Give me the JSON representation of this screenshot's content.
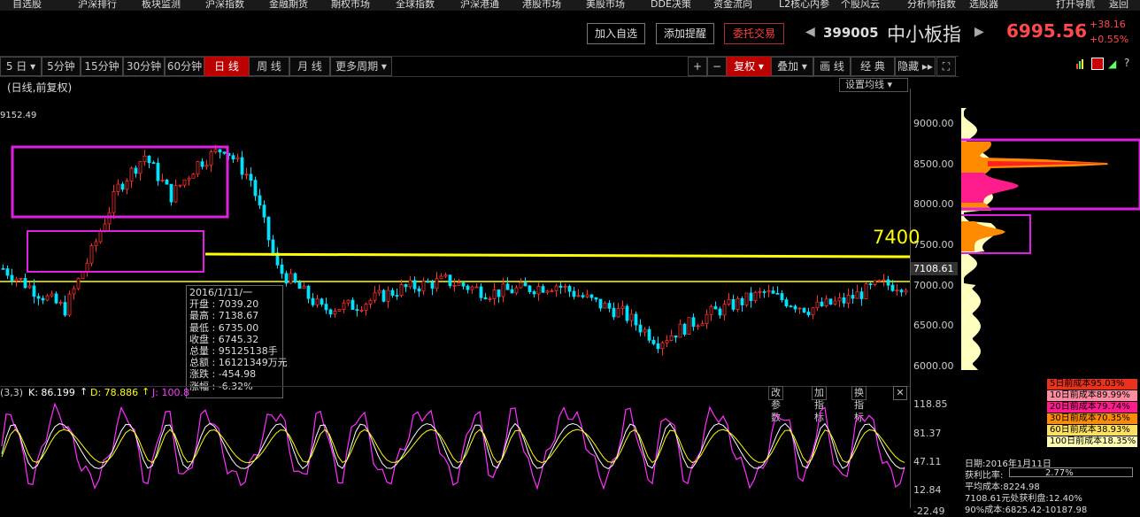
{
  "menu": [
    "自选股",
    "沪深排行",
    "板块监测",
    "沪深指数",
    "金融期货",
    "期权市场",
    "全球指数",
    "沪深港通",
    "港股市场",
    "美股市场",
    "DDE决策",
    "资金流向",
    "L2核心内参",
    "个股风云",
    "分析师指数",
    "选股器",
    "打开导航",
    "返回"
  ],
  "header": {
    "add_watch": "加入自选",
    "add_alert": "添加提醒",
    "trade": "委托交易",
    "code": "399005",
    "name": "中小板指",
    "price": "6995.56",
    "change": "+38.16",
    "change_pct": "+0.55%"
  },
  "toolbar": {
    "periods": [
      "5 日",
      "5分钟",
      "15分钟",
      "30分钟",
      "60分钟",
      "日 线",
      "周 线",
      "月 线",
      "更多周期"
    ],
    "active_period": "日 线",
    "right": [
      "+",
      "−",
      "复权",
      "叠加",
      "画 线",
      "经 典",
      "隐藏"
    ]
  },
  "chart": {
    "title": "(日线,前复权)",
    "setting_ma": "设置均线",
    "high_label": "9152.49",
    "current_value_label": "7108.61",
    "annotation": "7400",
    "yticks": [
      "9000.00",
      "8500.00",
      "8000.00",
      "7500.00",
      "7000.00",
      "6500.00",
      "6000.00"
    ]
  },
  "tooltip": {
    "date": "2016/1/11/一",
    "rows": [
      "开盘 : 7039.20",
      "最高 : 7138.67",
      "最低 : 6735.00",
      "收盘 : 6745.32",
      "总量 : 95125138手",
      "总额 : 16121349万元",
      "涨跌 : -454.98",
      "涨幅 : -6.32%"
    ]
  },
  "indicator": {
    "params": "(3,3)",
    "k": "K: 86.199",
    "d": "D: 78.886",
    "j": "J: 100.8",
    "buttons": [
      "改参数",
      "加指标",
      "换指标"
    ],
    "yticks": [
      "118.85",
      "81.37",
      "47.11",
      "12.84",
      "-22.49"
    ]
  },
  "cost_legend": [
    {
      "label": "5日前成本95.03%",
      "color": "#e8321e"
    },
    {
      "label": "10日前成本89.99%",
      "color": "#ff8ca0"
    },
    {
      "label": "20日前成本79.74%",
      "color": "#ff1c8c"
    },
    {
      "label": "30日前成本70.35%",
      "color": "#ff8c00"
    },
    {
      "label": "60日前成本38.93%",
      "color": "#ffe060"
    },
    {
      "label": "100日前成本18.35%",
      "color": "#ffffb0"
    }
  ],
  "cost_info": [
    "日期:2016年1月11日",
    "获利比率:",
    "2.77%",
    "平均成本:8224.98",
    "7108.61元处获利盘:12.40%",
    "90%成本:6825.42-10187.98"
  ],
  "colors": {
    "up": "#ff3030",
    "down": "#00e0ff",
    "highlight_box": "#e020e0",
    "annotation": "#ffff00"
  }
}
